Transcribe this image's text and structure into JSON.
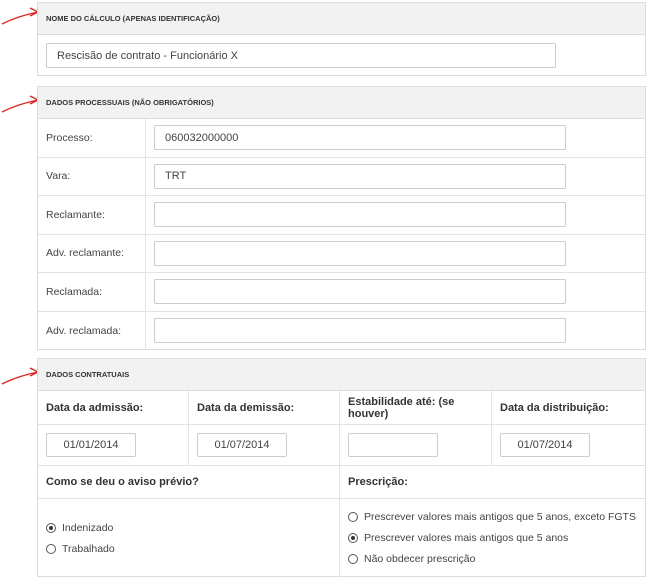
{
  "section1": {
    "title": "NOME DO CÁLCULO (APENAS IDENTIFICAÇÃO)",
    "name_value": "Rescisão de contrato - Funcionário X"
  },
  "section2": {
    "title": "DADOS PROCESSUAIS (NÃO OBRIGATÓRIOS)",
    "fields": [
      {
        "label": "Processo:",
        "value": "060032000000"
      },
      {
        "label": "Vara:",
        "value": "TRT"
      },
      {
        "label": "Reclamante:",
        "value": ""
      },
      {
        "label": "Adv. reclamante:",
        "value": ""
      },
      {
        "label": "Reclamada:",
        "value": ""
      },
      {
        "label": "Adv. reclamada:",
        "value": ""
      }
    ]
  },
  "section3": {
    "title": "DADOS CONTRATUAIS",
    "dates": [
      {
        "label": "Data da admissão:",
        "value": "01/01/2014"
      },
      {
        "label": "Data da demissão:",
        "value": "01/07/2014"
      },
      {
        "label": "Estabilidade até: (se houver)",
        "value": ""
      },
      {
        "label": "Data da distribuição:",
        "value": "01/07/2014"
      }
    ],
    "aviso": {
      "question": "Como se deu o aviso prévio?",
      "options": [
        {
          "label": "Indenizado",
          "selected": true
        },
        {
          "label": "Trabalhado",
          "selected": false
        }
      ]
    },
    "prescricao": {
      "question": "Prescrição:",
      "options": [
        {
          "label": "Prescrever valores mais antigos que 5 anos, exceto FGTS",
          "selected": false
        },
        {
          "label": "Prescrever valores mais antigos que 5 anos",
          "selected": true
        },
        {
          "label": "Não obdecer prescrição",
          "selected": false
        }
      ]
    }
  },
  "colors": {
    "arrow": "#d9261c",
    "header_bg": "#f2f2f2",
    "border": "#dcdcdc"
  }
}
